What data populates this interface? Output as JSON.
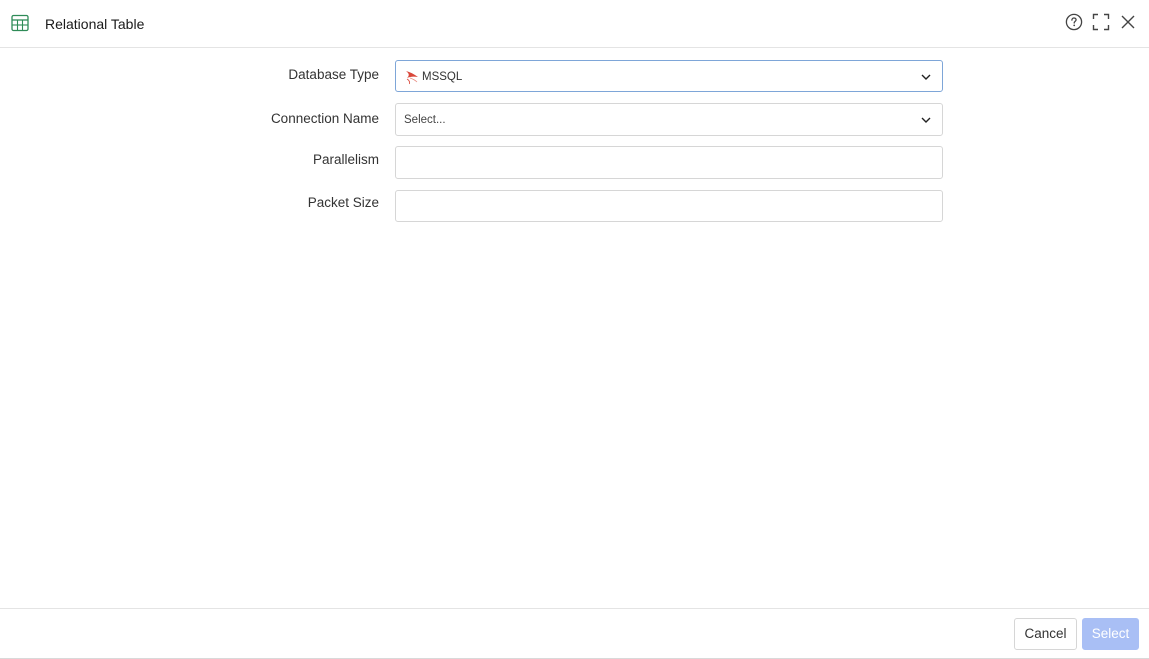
{
  "dialog": {
    "title": "Relational Table",
    "icons": {
      "title": "table-icon",
      "help": "help-circle-icon",
      "maximize": "maximize-icon",
      "close": "close-icon"
    }
  },
  "form": {
    "database_type": {
      "label": "Database Type",
      "value": "MSSQL",
      "icon": "mssql-icon"
    },
    "connection_name": {
      "label": "Connection Name",
      "placeholder": "Select..."
    },
    "parallelism": {
      "label": "Parallelism",
      "value": ""
    },
    "packet_size": {
      "label": "Packet Size",
      "value": ""
    }
  },
  "footer": {
    "cancel_label": "Cancel",
    "select_label": "Select"
  },
  "colors": {
    "accent_icon": "#2e8b57",
    "primary_disabled": "#a9bff5",
    "focus_border": "#7ea6d8",
    "mssql_red": "#d9473a"
  }
}
